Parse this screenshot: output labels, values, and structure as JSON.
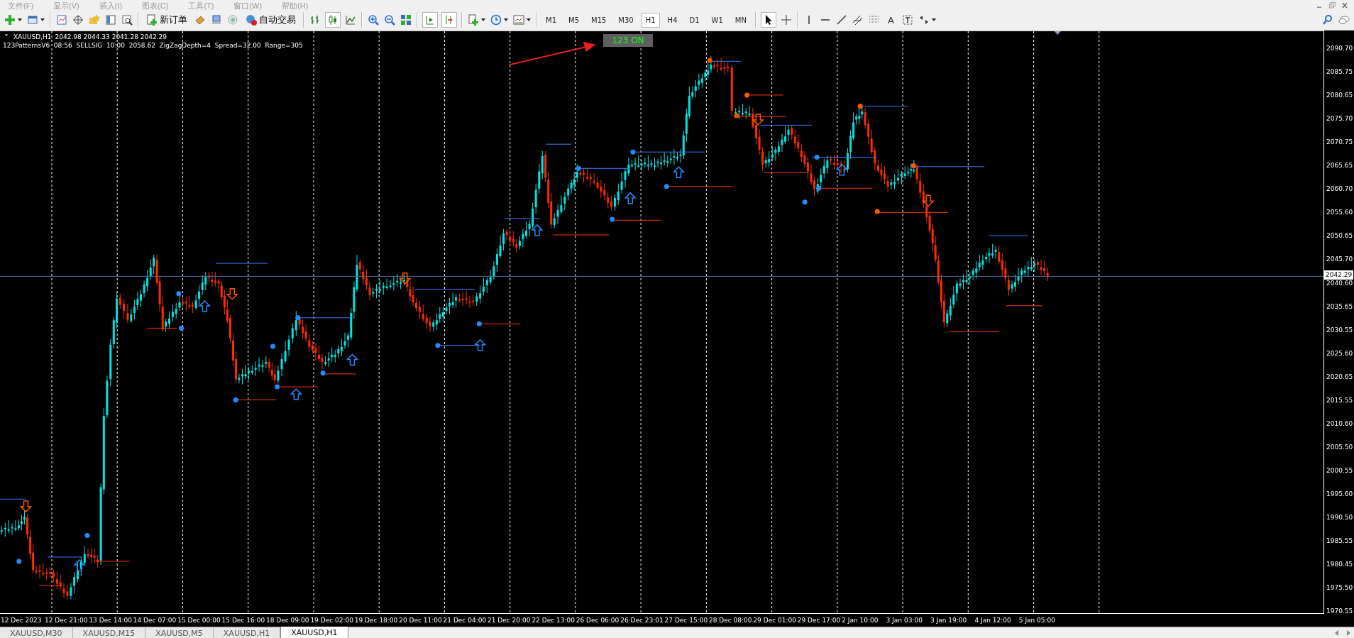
{
  "menu": [
    {
      "label": "文件(F)"
    },
    {
      "label": "显示(V)"
    },
    {
      "label": "插入(I)"
    },
    {
      "label": "图表(C)"
    },
    {
      "label": "工具(T)"
    },
    {
      "label": "窗口(W)"
    },
    {
      "label": "帮助(H)"
    }
  ],
  "toolbar": {
    "new_order": "新订单",
    "auto_trading": "自动交易",
    "text_tool": "A",
    "timeframes": [
      {
        "label": "M1",
        "selected": false
      },
      {
        "label": "M5",
        "selected": false
      },
      {
        "label": "M15",
        "selected": false
      },
      {
        "label": "M30",
        "selected": false
      },
      {
        "label": "H1",
        "selected": true
      },
      {
        "label": "H4",
        "selected": false
      },
      {
        "label": "D1",
        "selected": false
      },
      {
        "label": "W1",
        "selected": false
      },
      {
        "label": "MN",
        "selected": false
      }
    ]
  },
  "chart": {
    "symbol": "XAUUSD,H1",
    "ohlc": "2042.98 2044.33 2041.28 2042.29",
    "indicator_info": "123PatternsV6  08:56  SELLSIG  10:00  2058.62  ZigZagDepth=4  Spread=32.00  Range=305",
    "toggle_button": "123 ON",
    "price_axis": [
      "2090.70",
      "2085.75",
      "2080.65",
      "2075.70",
      "2070.75",
      "2065.65",
      "2060.70",
      "2055.60",
      "2050.65",
      "2045.70",
      "2040.60",
      "2035.65",
      "2030.55",
      "2025.60",
      "2020.65",
      "2015.55",
      "2010.60",
      "2005.50",
      "2000.55",
      "1995.60",
      "1990.50",
      "1985.55",
      "1980.45",
      "1975.50",
      "1970.55"
    ],
    "current_price": "2042.29",
    "time_axis": [
      "12 Dec 2023",
      "12 Dec 21:00",
      "13 Dec 14:00",
      "14 Dec 07:00",
      "15 Dec 00:00",
      "15 Dec 16:00",
      "18 Dec 09:00",
      "19 Dec 02:00",
      "19 Dec 18:00",
      "20 Dec 11:00",
      "21 Dec 04:00",
      "21 Dec 20:00",
      "22 Dec 13:00",
      "26 Dec 06:00",
      "26 Dec 23:01",
      "27 Dec 15:00",
      "28 Dec 08:00",
      "29 Dec 01:00",
      "29 Dec 17:00",
      "2 Jan 10:00",
      "3 Jan 03:00",
      "3 Jan 19:00",
      "4 Jan 12:00",
      "5 Jan 05:00"
    ]
  },
  "tabs": [
    {
      "label": "XAUUSD,M30",
      "selected": false
    },
    {
      "label": "XAUUSD,M15",
      "selected": false
    },
    {
      "label": "XAUUSD,M5",
      "selected": false
    },
    {
      "label": "XAUUSD,H1",
      "selected": false
    },
    {
      "label": "XAUUSD,H1",
      "selected": true
    }
  ]
}
